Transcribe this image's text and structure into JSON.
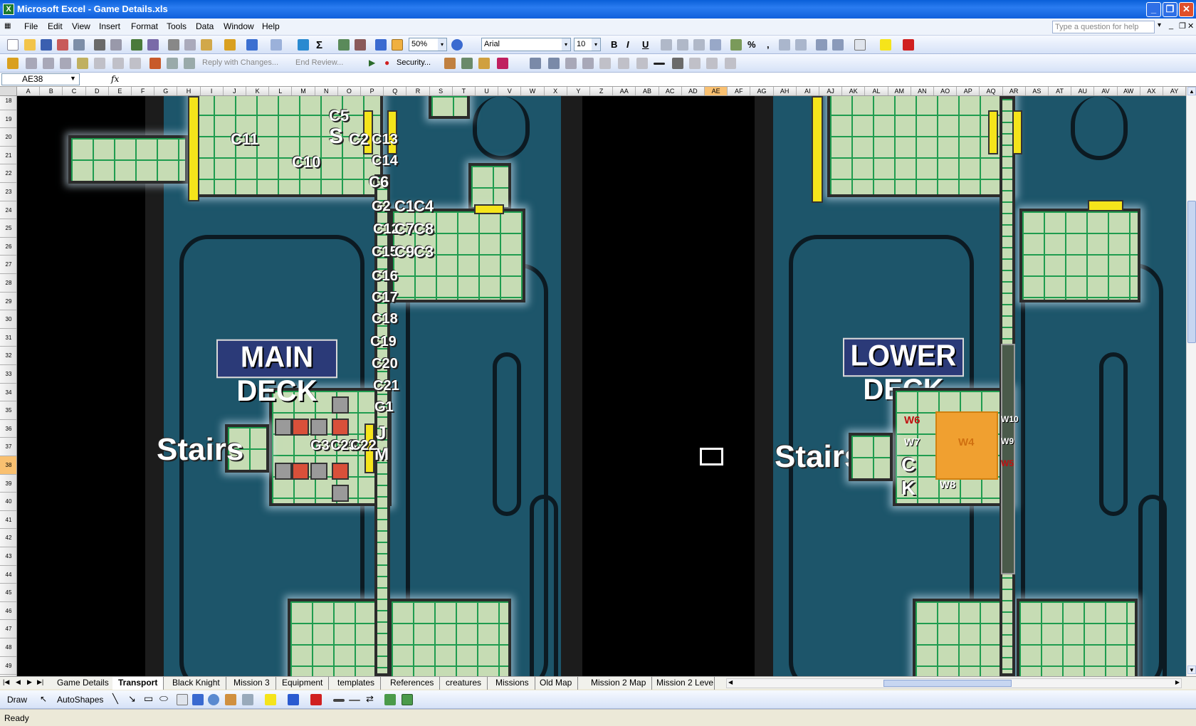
{
  "window": {
    "title": "Microsoft Excel - Game Details.xls"
  },
  "menu": [
    "File",
    "Edit",
    "View",
    "Insert",
    "Format",
    "Tools",
    "Data",
    "Window",
    "Help"
  ],
  "help_placeholder": "Type a question for help",
  "toolbar": {
    "zoom": "50%",
    "font": "Arial",
    "font_size": "10",
    "reply_label": "Reply with Changes...",
    "end_review_label": "End Review...",
    "security_label": "Security..."
  },
  "formula": {
    "name_box": "AE38",
    "fx": "fx"
  },
  "columns": [
    "A",
    "B",
    "C",
    "D",
    "E",
    "F",
    "G",
    "H",
    "I",
    "J",
    "K",
    "L",
    "M",
    "N",
    "O",
    "P",
    "Q",
    "R",
    "S",
    "T",
    "U",
    "V",
    "W",
    "X",
    "Y",
    "Z",
    "AA",
    "AB",
    "AC",
    "AD",
    "AE",
    "AF",
    "AG",
    "AH",
    "AI",
    "AJ",
    "AK",
    "AL",
    "AM",
    "AN",
    "AO",
    "AP",
    "AQ",
    "AR",
    "AS",
    "AT",
    "AU",
    "AV",
    "AW",
    "AX",
    "AY"
  ],
  "rows": [
    "18",
    "19",
    "20",
    "21",
    "22",
    "23",
    "24",
    "25",
    "26",
    "27",
    "28",
    "29",
    "30",
    "31",
    "32",
    "33",
    "34",
    "35",
    "36",
    "37",
    "38",
    "39",
    "40",
    "41",
    "42",
    "43",
    "44",
    "45",
    "46",
    "47",
    "48",
    "49"
  ],
  "map": {
    "main_deck": "MAIN DECK",
    "lower_deck": "LOWER DECK",
    "stairs": "Stairs",
    "labels_main": [
      "C5",
      "S",
      "C2",
      "C11",
      "C13",
      "C10",
      "C14",
      "C6",
      "G2",
      "C1",
      "C4",
      "C12",
      "C7",
      "C8",
      "C15",
      "C9",
      "C3",
      "C16",
      "C17",
      "C18",
      "C19",
      "C20",
      "C21",
      "G1",
      "J",
      "M",
      "G3",
      "C23",
      "C22"
    ],
    "labels_lower": [
      "W6",
      "W7",
      "W4",
      "W10",
      "W9",
      "W5",
      "C",
      "K",
      "W8"
    ]
  },
  "sheet_tabs": [
    "Game Details",
    "Transport",
    "Black Knight",
    "Mission 3",
    "Equipment",
    "templates",
    "References",
    "creatures",
    "Missions",
    "Old Map",
    "Mission 2 Map",
    "Mission 2 Leve"
  ],
  "active_tab": "Transport",
  "drawbar": {
    "draw": "Draw",
    "autoshapes": "AutoShapes"
  },
  "status": "Ready"
}
